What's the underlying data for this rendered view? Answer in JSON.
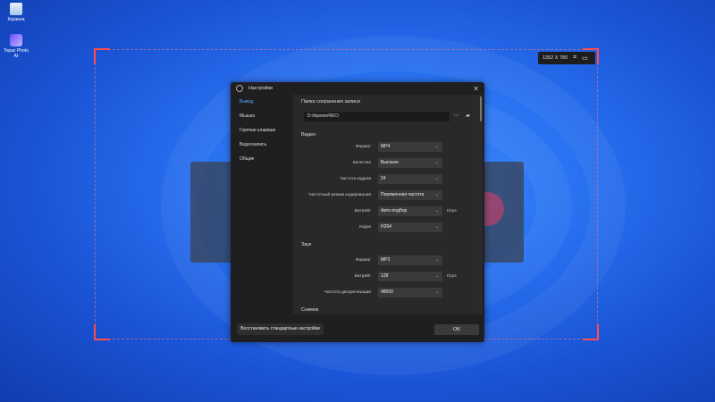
{
  "desktop": {
    "icons": [
      {
        "label": "Корзина",
        "icon": "recycle-bin-icon"
      },
      {
        "label": "Topaz Photo AI",
        "icon": "topaz-app-icon"
      }
    ]
  },
  "capture": {
    "size_text": "1352 X 780",
    "accent_color": "#ff4d4d"
  },
  "dialog": {
    "title": "Настройки",
    "nav": [
      "Вывод",
      "Мышка",
      "Горячие клавиши",
      "Видеозапись",
      "Общие"
    ],
    "save_folder_label": "Папка сохранения записи",
    "save_path": "D:\\ApowerREC\\",
    "video_section": "Видео",
    "video_rows": [
      {
        "label": "Формат",
        "value": "MP4",
        "unit": ""
      },
      {
        "label": "Качество",
        "value": "Высокое",
        "unit": ""
      },
      {
        "label": "Частота кадров",
        "value": "24",
        "unit": ""
      },
      {
        "label": "Частотный режим кодирования",
        "value": "Переменная частота",
        "unit": ""
      },
      {
        "label": "Битрейт",
        "value": "Авто-подбор",
        "unit": "Kbps"
      },
      {
        "label": "Кодек",
        "value": "H264",
        "unit": ""
      }
    ],
    "audio_section": "Звук",
    "audio_rows": [
      {
        "label": "Формат",
        "value": "MP3",
        "unit": ""
      },
      {
        "label": "Битрейт",
        "value": "128",
        "unit": "Kbps"
      },
      {
        "label": "Частота дискретизации",
        "value": "48000",
        "unit": ""
      }
    ],
    "screenshot_section": "Снимок",
    "reset_button": "Восстановить стандартные настройки",
    "ok_button": "OK",
    "accent_color": "#5aa7ff"
  }
}
